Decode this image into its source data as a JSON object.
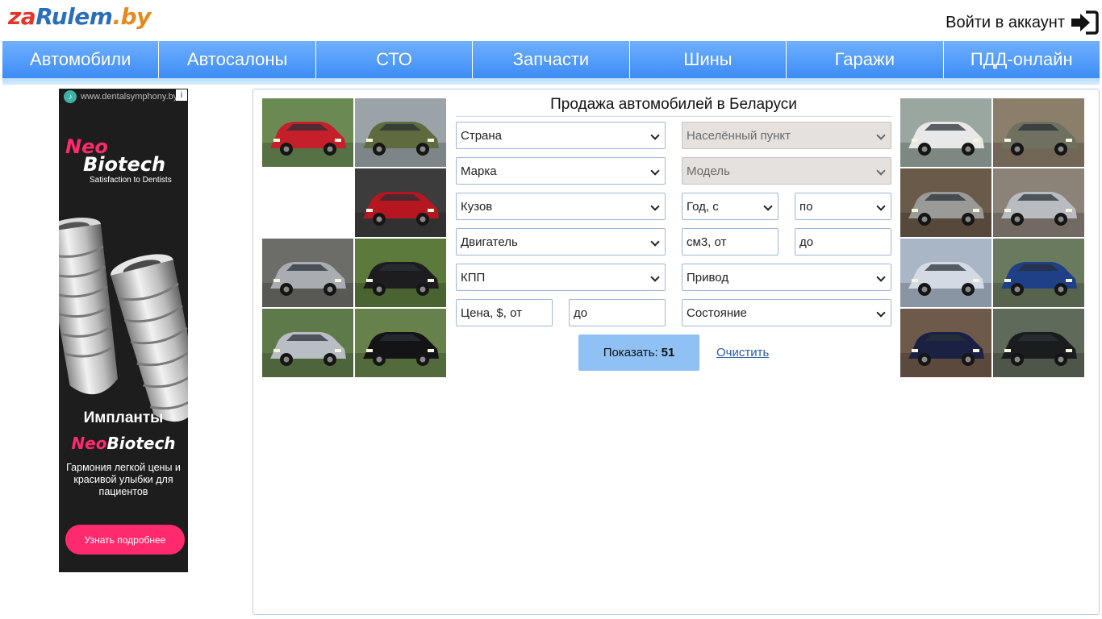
{
  "header": {
    "logo": {
      "za": "za",
      "rulem": "Rulem",
      "by": ".by"
    },
    "login_label": "Войти в аккаунт"
  },
  "nav": {
    "items": [
      "Автомобили",
      "Автосалоны",
      "СТО",
      "Запчасти",
      "Шины",
      "Гаражи",
      "ПДД-онлайн"
    ]
  },
  "ad": {
    "site": "www.dentalsymphony.by",
    "brand_line1": "Neo",
    "brand_line2": "Biotech",
    "tagline": "Satisfaction to Dentists",
    "heading": "Импланты",
    "logo_neo": "Neo",
    "logo_biotech": "Biotech",
    "description": "Гармония легкой цены и красивой улыбки для пациентов",
    "button": "Узнать подробнее",
    "info_icon": "i",
    "colors": {
      "accent": "#ff2a6d",
      "background": "#1d1d1d"
    }
  },
  "form": {
    "title": "Продажа автомобилей в Беларуси",
    "country": "Страна",
    "locality": "Населённый пункт",
    "brand": "Марка",
    "model": "Модель",
    "body": "Кузов",
    "year_from": "Год, с",
    "year_to": "по",
    "engine": "Двигатель",
    "cc_from": "см3, от",
    "cc_to": "до",
    "gearbox": "КПП",
    "drive": "Привод",
    "price_from": "Цена, $, от",
    "price_to": "до",
    "condition": "Состояние",
    "show_label": "Показать:",
    "show_count": "51",
    "clear_label": "Очистить"
  },
  "thumbnails": {
    "left": [
      {
        "name": "red-sedan",
        "color": "#c41f2a",
        "bg": "#6a8a52"
      },
      {
        "name": "military-truck",
        "color": "#5f6b3f",
        "bg": "#9aa3a8"
      },
      {
        "name": "empty"
      },
      {
        "name": "red-car-closeup",
        "color": "#b5161f",
        "bg": "#3c3c3c"
      },
      {
        "name": "silver-suv",
        "color": "#a9adb2",
        "bg": "#6c6c68"
      },
      {
        "name": "black-suv",
        "color": "#1d1d20",
        "bg": "#5b7a3c"
      },
      {
        "name": "silver-coupe",
        "color": "#b9bec4",
        "bg": "#5f7a4a"
      },
      {
        "name": "black-sedan",
        "color": "#141416",
        "bg": "#66824a"
      }
    ],
    "right": [
      {
        "name": "white-wagon",
        "color": "#e8e8e8",
        "bg": "#9aa6a0"
      },
      {
        "name": "grey-renault",
        "color": "#6f705f",
        "bg": "#8b7e6b"
      },
      {
        "name": "silver-mercedes",
        "color": "#9a9a98",
        "bg": "#6a5a4a"
      },
      {
        "name": "silver-van",
        "color": "#b8bcc0",
        "bg": "#8b8278"
      },
      {
        "name": "snowy-car",
        "color": "#d3dae4",
        "bg": "#a8b6c6"
      },
      {
        "name": "blue-bmw",
        "color": "#1f3f86",
        "bg": "#6a7a5e"
      },
      {
        "name": "dark-blue-sedan",
        "color": "#1a2142",
        "bg": "#6e5a4a"
      },
      {
        "name": "black-jeep",
        "color": "#1a1c1e",
        "bg": "#5f6a5a"
      }
    ]
  }
}
